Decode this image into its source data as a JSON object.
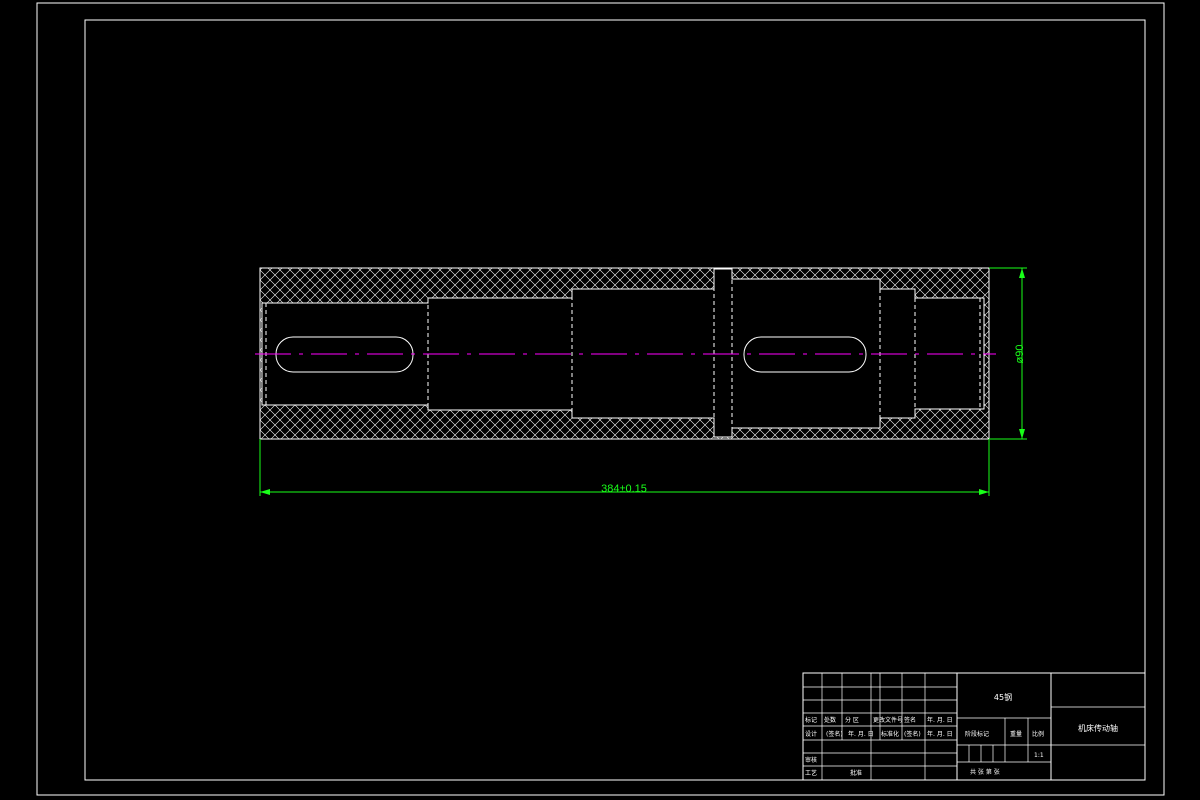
{
  "colors": {
    "background": "#000000",
    "outline": "#ffffff",
    "dimension": "#19ff19",
    "centerline": "#ff00ff"
  },
  "dimensions": {
    "length_label": "384±0.15",
    "diameter_label": "ø90"
  },
  "title_block": {
    "material": "45钢",
    "part_name": "机床传动轴",
    "scale": "1:1",
    "row_labels": {
      "mark": "标记",
      "count": "处数",
      "zone": "分 区",
      "change_doc": "更改文件号",
      "signature": "签名",
      "date": "年. 月. 日",
      "design": "设计",
      "design_sign": "(签名)",
      "design_date": "年. 月. 日",
      "standardize": "标准化",
      "std_sign": "(签名)",
      "std_date": "年. 月. 日",
      "review": "审核",
      "process": "工艺",
      "approve": "批准"
    },
    "stage_label": "阶段标记",
    "weight_label": "重量",
    "ratio_label": "比例",
    "sheets_label": "共    张    第    张"
  }
}
